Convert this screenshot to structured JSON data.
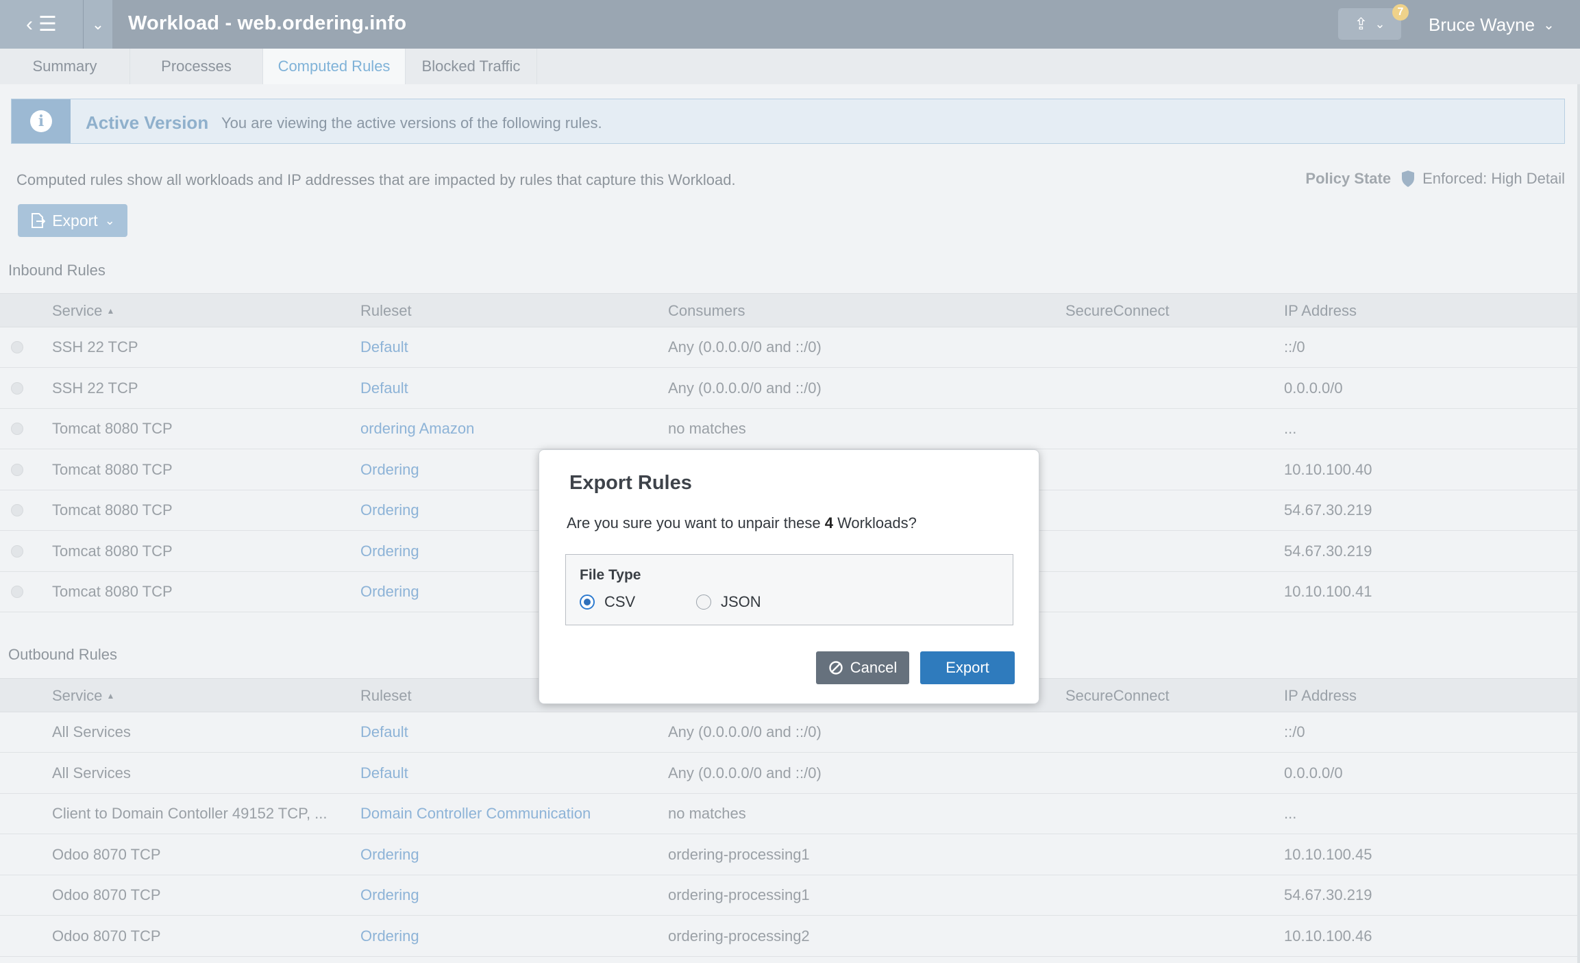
{
  "header": {
    "title": "Workload - web.ordering.info",
    "notification_count": "7",
    "user_name": "Bruce Wayne"
  },
  "tabs": [
    {
      "label": "Summary"
    },
    {
      "label": "Processes"
    },
    {
      "label": "Computed Rules"
    },
    {
      "label": "Blocked Traffic"
    }
  ],
  "banner": {
    "title": "Active Version",
    "text": "You are viewing the active versions of the following rules."
  },
  "description": "Computed rules show all workloads and IP addresses that are impacted by rules that capture this Workload.",
  "policy": {
    "label": "Policy State",
    "value": "Enforced: High Detail"
  },
  "export_button": "Export",
  "inbound": {
    "title": "Inbound Rules",
    "columns": [
      "Service",
      "Ruleset",
      "Consumers",
      "SecureConnect",
      "IP Address"
    ],
    "rows": [
      {
        "service": "SSH 22 TCP",
        "ruleset": "Default",
        "consumers": "Any (0.0.0.0/0 and ::/0)",
        "secure": "",
        "ip": "::/0"
      },
      {
        "service": "SSH 22 TCP",
        "ruleset": "Default",
        "consumers": "Any (0.0.0.0/0 and ::/0)",
        "secure": "",
        "ip": "0.0.0.0/0"
      },
      {
        "service": "Tomcat 8080 TCP",
        "ruleset": "ordering Amazon",
        "consumers": "no matches",
        "secure": "",
        "ip": "..."
      },
      {
        "service": "Tomcat 8080 TCP",
        "ruleset": "Ordering",
        "consumers": "",
        "secure": "",
        "ip": "10.10.100.40"
      },
      {
        "service": "Tomcat 8080 TCP",
        "ruleset": "Ordering",
        "consumers": "",
        "secure": "",
        "ip": "54.67.30.219"
      },
      {
        "service": "Tomcat 8080 TCP",
        "ruleset": "Ordering",
        "consumers": "",
        "secure": "",
        "ip": "54.67.30.219"
      },
      {
        "service": "Tomcat 8080 TCP",
        "ruleset": "Ordering",
        "consumers": "",
        "secure": "",
        "ip": "10.10.100.41"
      }
    ]
  },
  "outbound": {
    "title": "Outbound Rules",
    "columns": [
      "Service",
      "Ruleset",
      "",
      "SecureConnect",
      "IP Address"
    ],
    "rows": [
      {
        "service": "All Services",
        "ruleset": "Default",
        "consumers": "Any (0.0.0.0/0 and ::/0)",
        "secure": "",
        "ip": "::/0"
      },
      {
        "service": "All Services",
        "ruleset": "Default",
        "consumers": "Any (0.0.0.0/0 and ::/0)",
        "secure": "",
        "ip": "0.0.0.0/0"
      },
      {
        "service": "Client to Domain Contoller 49152 TCP, ...",
        "ruleset": "Domain Controller Communication",
        "consumers": "no matches",
        "secure": "",
        "ip": "..."
      },
      {
        "service": "Odoo 8070 TCP",
        "ruleset": "Ordering",
        "consumers": "ordering-processing1",
        "secure": "",
        "ip": "10.10.100.45"
      },
      {
        "service": "Odoo 8070 TCP",
        "ruleset": "Ordering",
        "consumers": "ordering-processing1",
        "secure": "",
        "ip": "54.67.30.219"
      },
      {
        "service": "Odoo 8070 TCP",
        "ruleset": "Ordering",
        "consumers": "ordering-processing2",
        "secure": "",
        "ip": "10.10.100.46"
      }
    ]
  },
  "modal": {
    "title": "Export Rules",
    "question_prefix": "Are you sure you want to unpair these",
    "question_count": "4",
    "question_suffix": "Workloads?",
    "file_type_label": "File Type",
    "options": [
      {
        "label": "CSV",
        "selected": true
      },
      {
        "label": "JSON",
        "selected": false
      }
    ],
    "cancel_label": "Cancel",
    "export_label": "Export"
  }
}
